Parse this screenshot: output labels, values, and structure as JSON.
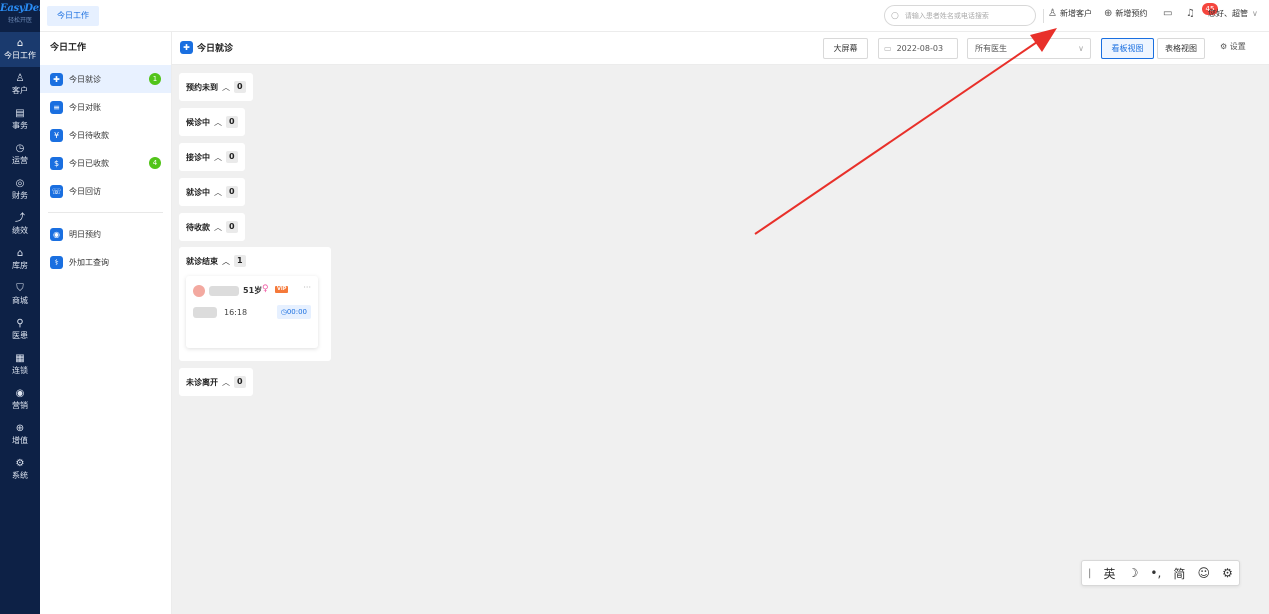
{
  "nav": {
    "logo": "EasyDent",
    "logo_sub": "轻松开医",
    "items": [
      {
        "icon": "⌂",
        "label": "今日工作"
      },
      {
        "icon": "♙",
        "label": "客户"
      },
      {
        "icon": "▤",
        "label": "事务"
      },
      {
        "icon": "◷",
        "label": "运营"
      },
      {
        "icon": "◎",
        "label": "财务"
      },
      {
        "icon": "⤴",
        "label": "绩效"
      },
      {
        "icon": "⌂",
        "label": "库房"
      },
      {
        "icon": "⛉",
        "label": "商城"
      },
      {
        "icon": "⚲",
        "label": "医患"
      },
      {
        "icon": "▦",
        "label": "连锁"
      },
      {
        "icon": "◉",
        "label": "营销"
      },
      {
        "icon": "⊕",
        "label": "增值"
      },
      {
        "icon": "⚙",
        "label": "系统"
      }
    ]
  },
  "header": {
    "tab": "今日工作",
    "search_placeholder": "请输入患者姓名或电话搜索",
    "new_customer": "新增客户",
    "new_appointment": "新增预约",
    "notification_count": "45",
    "greeting": "您好、超管"
  },
  "subnav": {
    "title": "今日工作",
    "items": [
      {
        "label": "今日就诊",
        "count": "1"
      },
      {
        "label": "今日对账"
      },
      {
        "label": "今日待收款"
      },
      {
        "label": "今日已收款",
        "count": "4"
      },
      {
        "label": "今日回访"
      }
    ],
    "items2": [
      {
        "label": "明日预约"
      },
      {
        "label": "外加工查询"
      }
    ]
  },
  "toolbar": {
    "title": "今日就诊",
    "big_screen": "大屏幕",
    "date": "2022-08-03",
    "doctor_select": "所有医生",
    "board_view": "看板视图",
    "table_view": "表格视图",
    "settings": "设置"
  },
  "groups": [
    {
      "label": "预约未到",
      "count": "0"
    },
    {
      "label": "候诊中",
      "count": "0"
    },
    {
      "label": "接诊中",
      "count": "0"
    },
    {
      "label": "就诊中",
      "count": "0"
    },
    {
      "label": "待收款",
      "count": "0"
    },
    {
      "label": "就诊结束",
      "count": "1"
    },
    {
      "label": "未诊离开",
      "count": "0"
    }
  ],
  "card": {
    "age": "51岁",
    "vip": "VIP",
    "time": "16:18",
    "timer": "00:00"
  },
  "ime": {
    "lang": "英",
    "simplified": "简"
  },
  "colors": {
    "nav_bg": "#0d2146",
    "primary": "#1a6fe0",
    "count_green": "#52c41a",
    "badge_red": "#f5453d",
    "arrow_red": "#e8302a"
  }
}
